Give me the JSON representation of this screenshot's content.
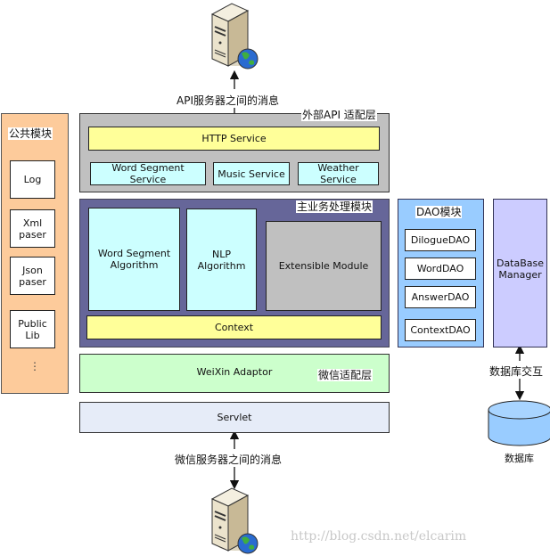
{
  "top_server": {
    "icon": "server-globe-icon"
  },
  "bottom_server": {
    "icon": "server-globe-icon"
  },
  "captions": {
    "api_message": "API服务器之间的消息",
    "weixin_message": "微信服务器之间的消息",
    "db_interaction": "数据库交互",
    "database": "数据库"
  },
  "common_module": {
    "title": "公共模块",
    "items": [
      "Log",
      "Xml\npaser",
      "Json\npaser",
      "Public\nLib"
    ],
    "ellipsis": "⋮"
  },
  "api_adaptor": {
    "title": "外部API 适配层",
    "http": "HTTP Service",
    "services": [
      "Word Segment\nService",
      "Music Service",
      "Weather\nService"
    ]
  },
  "business": {
    "title": "主业务处理模块",
    "modules": [
      "Word Segment\nAlgorithm",
      "NLP\nAlgorithm",
      "Extensible Module"
    ],
    "context": "Context"
  },
  "weixin_adaptor": {
    "label": "WeiXin Adaptor",
    "title": "微信适配层"
  },
  "servlet": {
    "label": "Servlet"
  },
  "dao_module": {
    "title": "DAO模块",
    "items": [
      "DilogueDAO",
      "WordDAO",
      "AnswerDAO",
      "ContextDAO"
    ]
  },
  "db_manager": {
    "label": "DataBase\nManager"
  },
  "watermark": "http://blog.csdn.net/elcarim",
  "colors": {
    "common_bg": "#fdcb9b",
    "api_bg": "#c0c0c0",
    "yellow": "#ffff99",
    "cyan": "#ccffff",
    "business_bg": "#666699",
    "weixin_bg": "#ccffcc",
    "servlet_bg": "#e6ecf8",
    "dao_bg": "#99ccff",
    "dbm_bg": "#ccccff",
    "db_cylinder": "#99ccff"
  }
}
